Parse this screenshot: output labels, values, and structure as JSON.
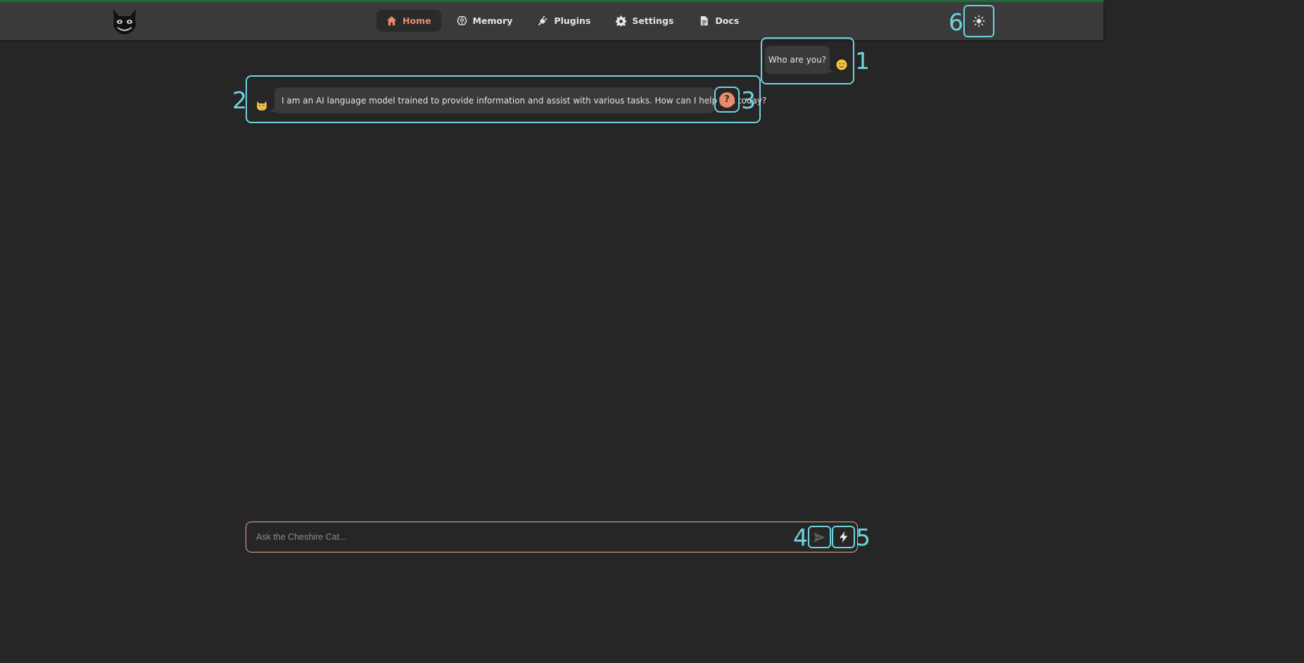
{
  "header": {
    "nav": [
      {
        "label": "Home",
        "icon": "home-icon",
        "active": true
      },
      {
        "label": "Memory",
        "icon": "brain-icon",
        "active": false
      },
      {
        "label": "Plugins",
        "icon": "plug-icon",
        "active": false
      },
      {
        "label": "Settings",
        "icon": "gear-icon",
        "active": false
      },
      {
        "label": "Docs",
        "icon": "document-icon",
        "active": false
      }
    ],
    "theme_toggle_icon": "sun-icon"
  },
  "messages": [
    {
      "sender": "user",
      "text": "Who are you?",
      "avatar": "slightly-smiling-face-icon"
    },
    {
      "sender": "bot",
      "text": "I am an AI language model trained to provide information and assist with various tasks. How can I help you today?",
      "avatar": "smiling-cat-icon",
      "why_label": "?"
    }
  ],
  "chat_input": {
    "placeholder": "Ask the Cheshire Cat...",
    "value": "",
    "send_icon": "send-icon",
    "prompt_icon": "lightning-bolt-icon"
  },
  "annotations": [
    "1",
    "2",
    "3",
    "4",
    "5",
    "6"
  ],
  "colors": {
    "background": "#262626",
    "header": "#3a3a3a",
    "accent": "#e88c6d",
    "annotation": "#6fd3e0"
  }
}
